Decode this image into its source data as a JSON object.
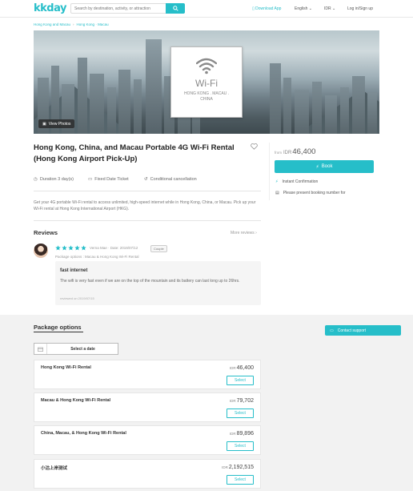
{
  "header": {
    "logo": "kkday",
    "search_placeholder": "Search by destination, activity, or attraction",
    "download_app": "Download App",
    "language": "English",
    "currency": "IDR",
    "login": "Log in/Sign up"
  },
  "breadcrumb": [
    "Hong Kong and Macau",
    "Hong Kong · Macau"
  ],
  "hero": {
    "wifi_title": "Wi-Fi",
    "wifi_subtitle": "HONG KONG . MACAU . CHINA",
    "view_photos": "View Photos"
  },
  "product": {
    "title": "Hong Kong, China, and Macau Portable 4G Wi-Fi Rental (Hong Kong Airport Pick-Up)",
    "duration": "Duration 3 day(s)",
    "ticket_type": "Fixed Date Ticket",
    "cancellation": "Conditional cancellation",
    "description": "Get your 4G portable Wi-Fi rental to access unlimited, high-speed internet while in Hong Kong, China, or Macau. Pick up your Wi-Fi rental at Hong Kong International Airport (HKG)."
  },
  "price_panel": {
    "from_label": "from",
    "currency": "IDR",
    "amount": "46,400",
    "book_label": "Book",
    "instant_confirmation": "Instant Confirmation",
    "booking_note": "Please present booking number for"
  },
  "reviews": {
    "title": "Reviews",
    "more_label": "More reviews",
    "rating": 5,
    "reviewer": "Verna Mae · Date: 2019/07/12",
    "badge": "Couple",
    "package_option": "Package options : Macau & Hong Kong Wi-Fi Rental",
    "review_title": "fast internet",
    "review_body": "The wifi is very fast even if we are on the top of the mountain and its battery can last long up to 26hrs.",
    "review_date": "reviewed on 2019/07/15"
  },
  "packages": {
    "title": "Package options",
    "select_date": "Select a date",
    "contact_support": "Contact support",
    "select_label": "Select",
    "currency": "IDR",
    "items": [
      {
        "name": "Hong Kong Wi-Fi Rental",
        "price": "46,400"
      },
      {
        "name": "Macau & Hong Kong Wi-Fi Rental",
        "price": "79,702"
      },
      {
        "name": "China, Macau, & Hong Kong Wi-Fi Rental",
        "price": "89,896"
      },
      {
        "name": "小沽上岸测试",
        "price": "2,192,515"
      }
    ]
  },
  "colors": {
    "brand": "#26bec9",
    "star": "#26bec9"
  }
}
